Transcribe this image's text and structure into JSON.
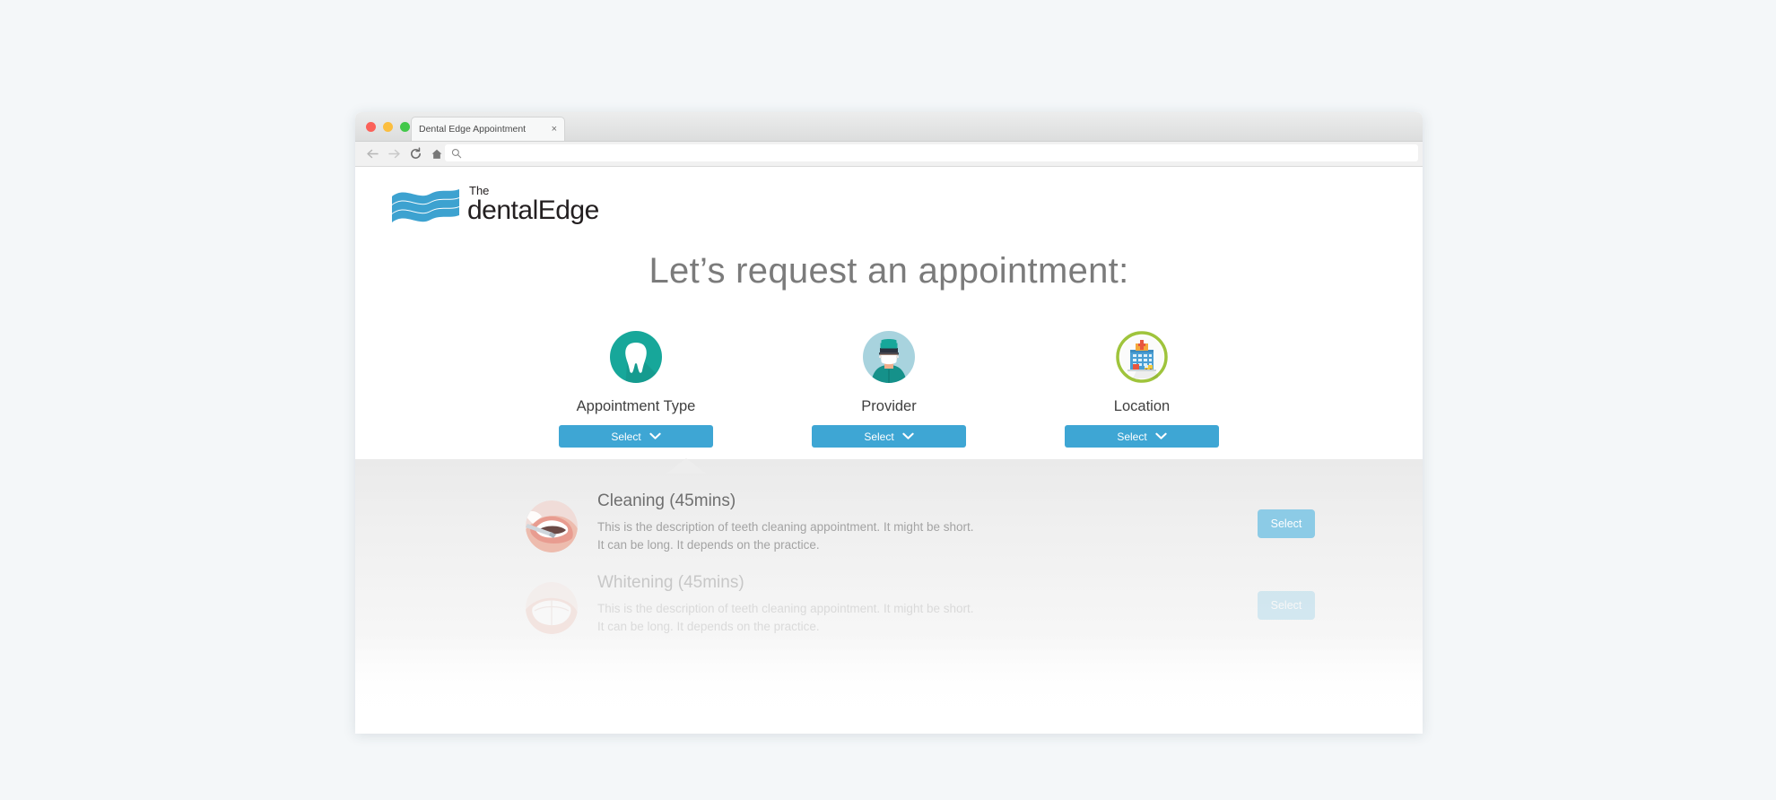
{
  "browser": {
    "tab_title": "Dental Edge Appointment",
    "tab_close_label": "×",
    "address_value": "",
    "address_placeholder": "",
    "nav": {
      "back": "back-arrow",
      "forward": "forward-arrow",
      "reload": "reload",
      "home": "home",
      "search": "search"
    }
  },
  "page": {
    "logo": {
      "the": "The",
      "name": "dentalEdge"
    },
    "title": "Let’s request an appointment:",
    "selectors": [
      {
        "label": "Appointment Type",
        "button_label": "Select",
        "icon": "tooth-icon",
        "active": true
      },
      {
        "label": "Provider",
        "button_label": "Select",
        "icon": "dentist-avatar-icon",
        "active": false
      },
      {
        "label": "Location",
        "button_label": "Select",
        "icon": "clinic-building-icon",
        "active": false
      }
    ],
    "results": [
      {
        "title": "Cleaning (45mins)",
        "description": "This is the description of teeth cleaning appointment. It might be short. It can be long. It depends on the practice.",
        "select_label": "Select",
        "thumb": "teeth-cleaning-photo"
      },
      {
        "title": "Whitening (45mins)",
        "description": "This is the description of teeth cleaning appointment. It might be short. It can be long. It depends on the practice.",
        "select_label": "Select",
        "thumb": "teeth-whitening-photo"
      }
    ]
  },
  "colors": {
    "page_background": "#f4f7f9",
    "brand_blue": "#3ea6d4",
    "logo_blue": "#3da2d0",
    "tooth_teal": "#17a79a",
    "avatar_blue": "#a8d3de",
    "location_green": "#9fc43c",
    "select_light_blue": "#8ccbe6",
    "title_gray": "#7b7b7b"
  }
}
